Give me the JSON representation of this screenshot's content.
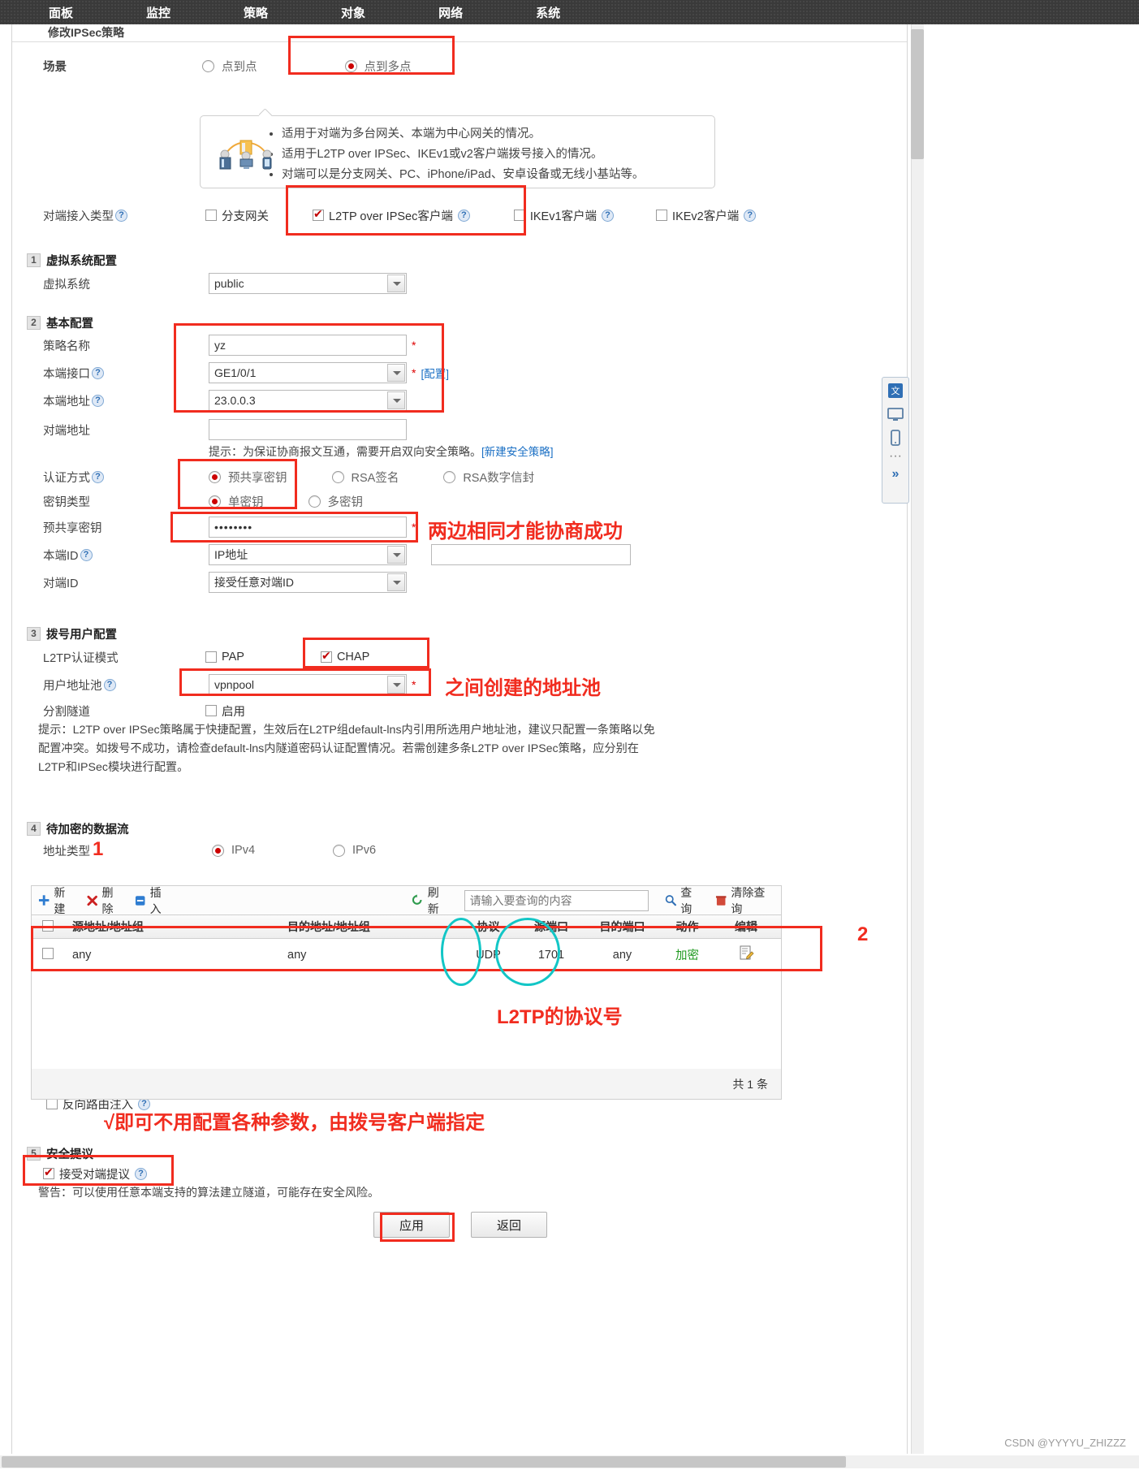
{
  "topnav": {
    "items": [
      {
        "label": "面板",
        "active": false
      },
      {
        "label": "监控",
        "active": false
      },
      {
        "label": "策略",
        "active": false
      },
      {
        "label": "对象",
        "active": false
      },
      {
        "label": "网络",
        "active": true
      },
      {
        "label": "系统",
        "active": false
      }
    ]
  },
  "breadcrumb": "修改IPSec策略",
  "scene": {
    "label": "场景",
    "options": [
      {
        "label": "点到点",
        "selected": false
      },
      {
        "label": "点到多点",
        "selected": true
      }
    ]
  },
  "callout": {
    "bullets": [
      "适用于对端为多台网关、本端为中心网关的情况。",
      "适用于L2TP over IPSec、IKEv1或v2客户端拨号接入的情况。",
      "对端可以是分支网关、PC、iPhone/iPad、安卓设备或无线小基站等。"
    ]
  },
  "peer_access": {
    "label": "对端接入类型",
    "options": [
      {
        "label": "分支网关",
        "checked": false,
        "help": false
      },
      {
        "label": "L2TP over IPSec客户端",
        "checked": true,
        "help": true
      },
      {
        "label": "IKEv1客户端",
        "checked": false,
        "help": true
      },
      {
        "label": "IKEv2客户端",
        "checked": false,
        "help": true
      }
    ]
  },
  "section1": {
    "num": "1",
    "title": "虚拟系统配置",
    "vsys_label": "虚拟系统",
    "vsys_value": "public"
  },
  "section2": {
    "num": "2",
    "title": "基本配置",
    "policy_name_label": "策略名称",
    "policy_name_value": "yz",
    "local_if_label": "本端接口",
    "local_if_value": "GE1/0/1",
    "local_if_link": "[配置]",
    "local_addr_label": "本端地址",
    "local_addr_value": "23.0.0.3",
    "peer_addr_label": "对端地址",
    "peer_addr_value": "",
    "tip_text": "提示：为保证协商报文互通，需要开启双向安全策略。",
    "tip_link": "[新建安全策略]",
    "auth_label": "认证方式",
    "auth_options": [
      {
        "label": "预共享密钥",
        "selected": true
      },
      {
        "label": "RSA签名",
        "selected": false
      },
      {
        "label": "RSA数字信封",
        "selected": false
      }
    ],
    "key_type_label": "密钥类型",
    "key_type_options": [
      {
        "label": "单密钥",
        "selected": true
      },
      {
        "label": "多密钥",
        "selected": false
      }
    ],
    "psk_label": "预共享密钥",
    "psk_value": "••••••••",
    "local_id_label": "本端ID",
    "local_id_value": "IP地址",
    "local_id_text": "",
    "peer_id_label": "对端ID",
    "peer_id_value": "接受任意对端ID"
  },
  "section3": {
    "num": "3",
    "title": "拨号用户配置",
    "l2tp_auth_label": "L2TP认证模式",
    "l2tp_auth_options": [
      {
        "label": "PAP",
        "checked": false
      },
      {
        "label": "CHAP",
        "checked": true
      }
    ],
    "pool_label": "用户地址池",
    "pool_value": "vpnpool",
    "split_label": "分割隧道",
    "split_option": "启用",
    "split_checked": false,
    "hint": "提示：L2TP over IPSec策略属于快捷配置，生效后在L2TP组default-lns内引用所选用户地址池，建议只配置一条策略以免配置冲突。如拨号不成功，请检查default-lns内隧道密码认证配置情况。若需创建多条L2TP over IPSec策略，应分别在L2TP和IPSec模块进行配置。"
  },
  "section4": {
    "num": "4",
    "title": "待加密的数据流",
    "addr_type_label": "地址类型",
    "addr_type_options": [
      {
        "label": "IPv4",
        "selected": true
      },
      {
        "label": "IPv6",
        "selected": false
      }
    ],
    "toolbar": {
      "new": "新建",
      "delete": "删除",
      "insert": "插入",
      "refresh": "刷新",
      "search_placeholder": "请输入要查询的内容",
      "search_value": "",
      "query": "查询",
      "clear_query": "清除查询"
    },
    "columns": [
      "",
      "源地址/地址组",
      "目的地址/地址组",
      "协议",
      "源端口",
      "目的端口",
      "动作",
      "编辑"
    ],
    "rows": [
      {
        "checked": false,
        "src": "any",
        "dst": "any",
        "proto": "UDP",
        "sport": "1701",
        "dport": "any",
        "action": "加密",
        "edit": "edit-icon"
      }
    ],
    "footer": "共 1 条",
    "reverse_route_label": "反向路由注入",
    "reverse_route_checked": false
  },
  "section5": {
    "num": "5",
    "title": "安全提议",
    "accept_label": "接受对端提议",
    "accept_checked": true,
    "warning": "警告：可以使用任意本端支持的算法建立隧道，可能存在安全风险。"
  },
  "footer_buttons": {
    "apply": "应用",
    "back": "返回"
  },
  "annotations": {
    "psk_note": "两边相同才能协商成功",
    "pool_note": "之间创建的地址池",
    "marker1": "1",
    "marker2": "2",
    "l2tp_proto_note": "L2TP的协议号",
    "accept_note": "√即可不用配置各种参数，由拨号客户端指定"
  },
  "watermark": "CSDN @YYYYU_ZHIZZZ",
  "colors": {
    "annotation_red": "#f12c1f",
    "annotation_cyan": "#12c6c6",
    "link_blue": "#1a6fc4",
    "action_green": "#1f9a1f"
  }
}
